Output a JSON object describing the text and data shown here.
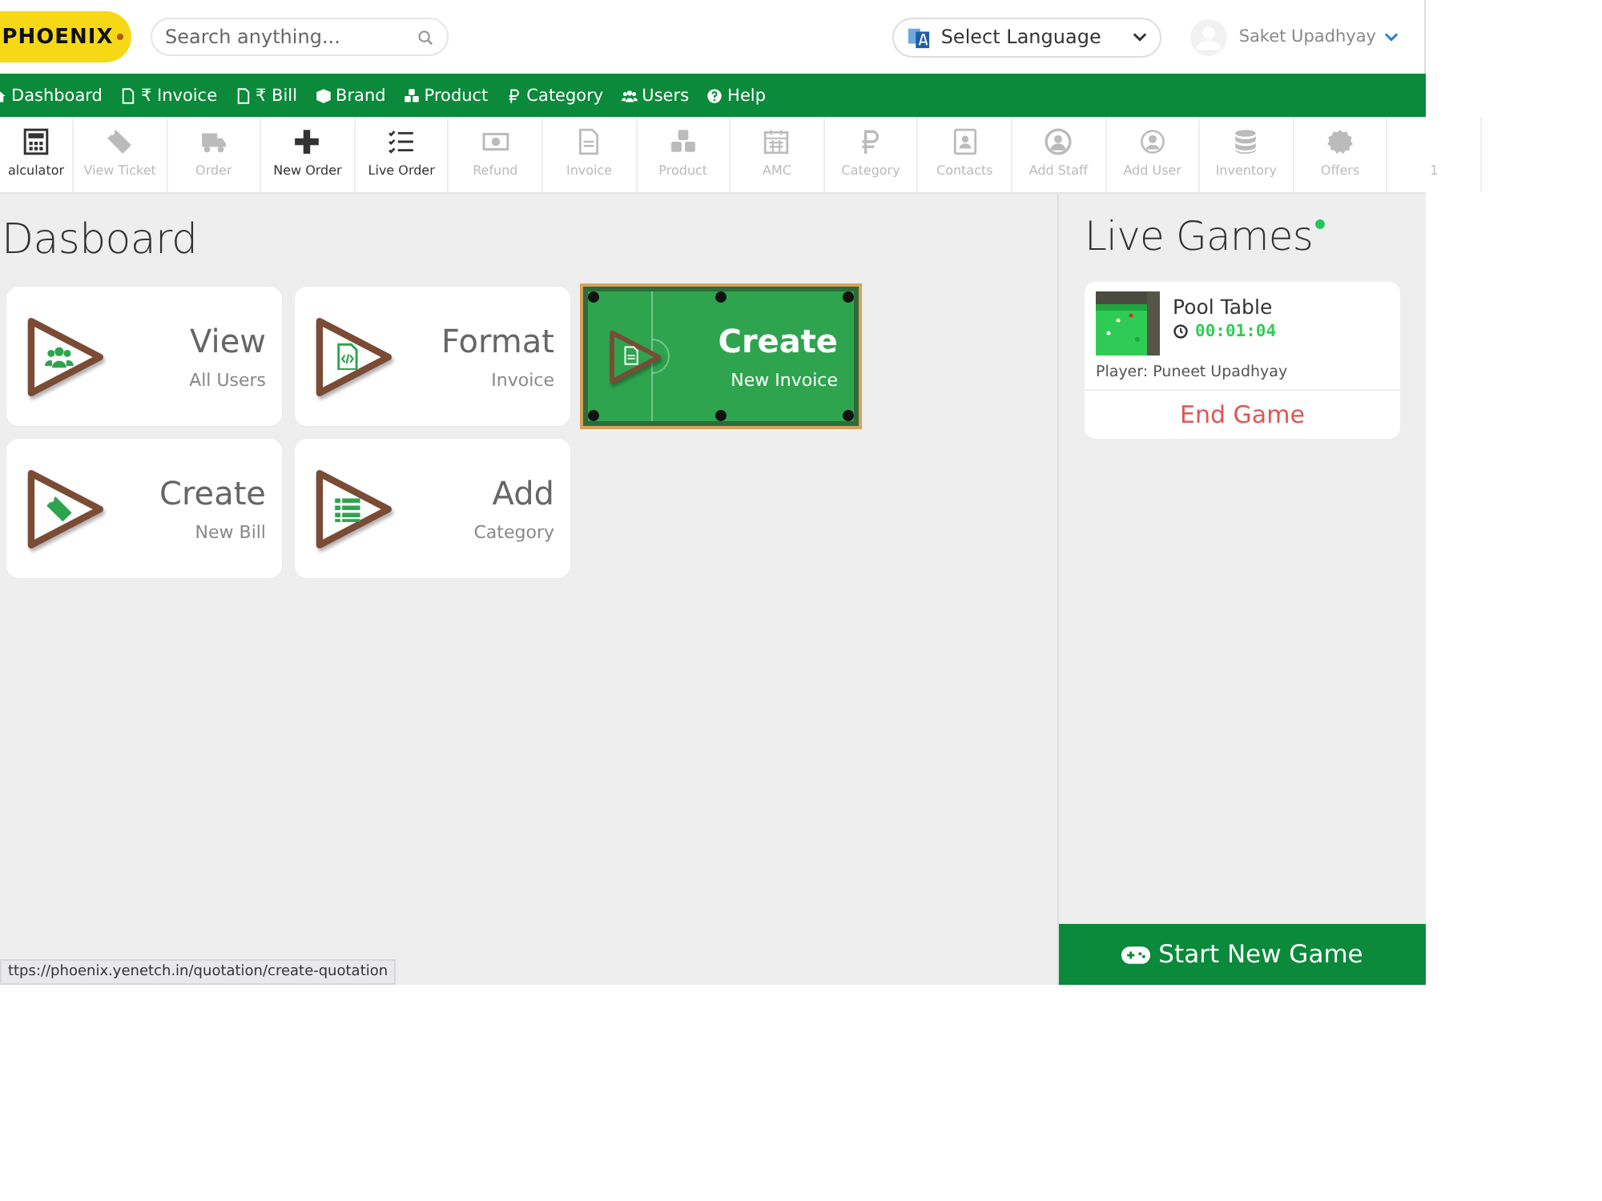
{
  "header": {
    "logo": "PHOENIX",
    "search": {
      "placeholder": "Search anything..."
    },
    "language_select": {
      "value": "Select Language"
    },
    "user": {
      "name": "Saket Upadhyay"
    }
  },
  "nav": [
    {
      "label": "Dashboard"
    },
    {
      "label": "₹ Invoice"
    },
    {
      "label": "₹ Bill"
    },
    {
      "label": "Brand"
    },
    {
      "label": "Product"
    },
    {
      "label": "Category"
    },
    {
      "label": "Users"
    },
    {
      "label": "Help"
    }
  ],
  "toolbar": [
    {
      "label": "alculator",
      "disabled": false
    },
    {
      "label": "View Ticket",
      "disabled": true
    },
    {
      "label": "Order",
      "disabled": true
    },
    {
      "label": "New Order",
      "disabled": false
    },
    {
      "label": "Live Order",
      "disabled": false
    },
    {
      "label": "Refund",
      "disabled": true
    },
    {
      "label": "Invoice",
      "disabled": true
    },
    {
      "label": "Product",
      "disabled": true
    },
    {
      "label": "AMC",
      "disabled": true
    },
    {
      "label": "Category",
      "disabled": true
    },
    {
      "label": "Contacts",
      "disabled": true
    },
    {
      "label": "Add Staff",
      "disabled": true
    },
    {
      "label": "Add User",
      "disabled": true
    },
    {
      "label": "Inventory",
      "disabled": true
    },
    {
      "label": "Offers",
      "disabled": true
    },
    {
      "label": "1",
      "disabled": true
    }
  ],
  "page_title": "Dasboard",
  "tiles": [
    {
      "title": "View",
      "subtitle": "All Users",
      "kind": "card"
    },
    {
      "title": "Format",
      "subtitle": "Invoice",
      "kind": "card"
    },
    {
      "title": "Create",
      "subtitle": "New Invoice",
      "kind": "pool-table"
    },
    {
      "title": "Create",
      "subtitle": "New Bill",
      "kind": "card"
    },
    {
      "title": "Add",
      "subtitle": "Category",
      "kind": "card"
    }
  ],
  "live_games": {
    "title": "Live Games",
    "games": [
      {
        "kind": "picture",
        "name": "Pool Table",
        "timer": "00:01:04",
        "player": "Player: Puneet Upadhyay",
        "action": "End Game"
      }
    ],
    "start_button": "Start New Game"
  },
  "status_url": "ttps://phoenix.yenetch.in/quotation/create-quotation"
}
